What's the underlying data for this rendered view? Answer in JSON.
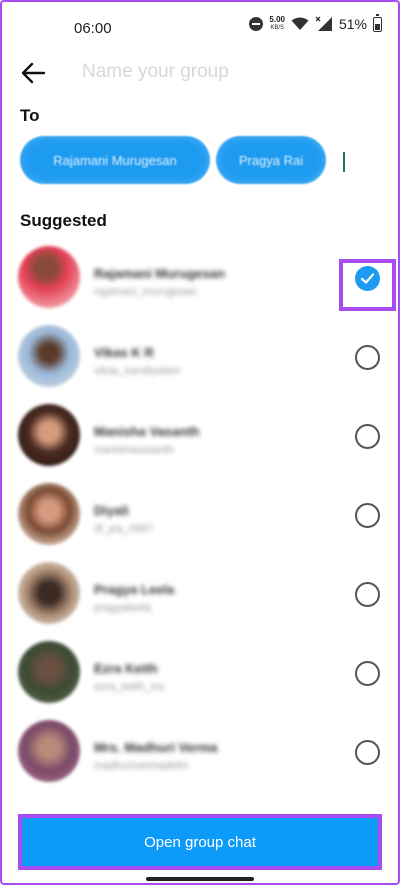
{
  "status_bar": {
    "time": "06:00",
    "speed_value": "5.00",
    "speed_unit": "KB/S",
    "battery": "51%"
  },
  "header": {
    "group_name_placeholder": "Name your group"
  },
  "recipients": {
    "label": "To",
    "chips": [
      "Rajamani Murugesan",
      "Pragya Rai"
    ]
  },
  "suggested": {
    "label": "Suggested",
    "items": [
      {
        "name": "Rajamani Murugesan",
        "handle": "rajamani_murugesan",
        "checked": true
      },
      {
        "name": "Vikas K R",
        "handle": "vikas_kandiyalam",
        "checked": false
      },
      {
        "name": "Manisha Vasanth",
        "handle": "manishavasanth",
        "checked": false
      },
      {
        "name": "Diyali",
        "handle": "dl_yia_0987",
        "checked": false
      },
      {
        "name": "Pragya Leela",
        "handle": "pragyaleela",
        "checked": false
      },
      {
        "name": "Ezra Keith",
        "handle": "ezra_keith_inc",
        "checked": false
      },
      {
        "name": "Mrs. Madhuri Verma",
        "handle": "madhurivermadelhi",
        "checked": false
      }
    ]
  },
  "footer": {
    "cta_label": "Open group chat"
  },
  "colors": {
    "accent": "#1d9bf0",
    "cta": "#0d9bfa",
    "highlight": "#a64cf0"
  }
}
